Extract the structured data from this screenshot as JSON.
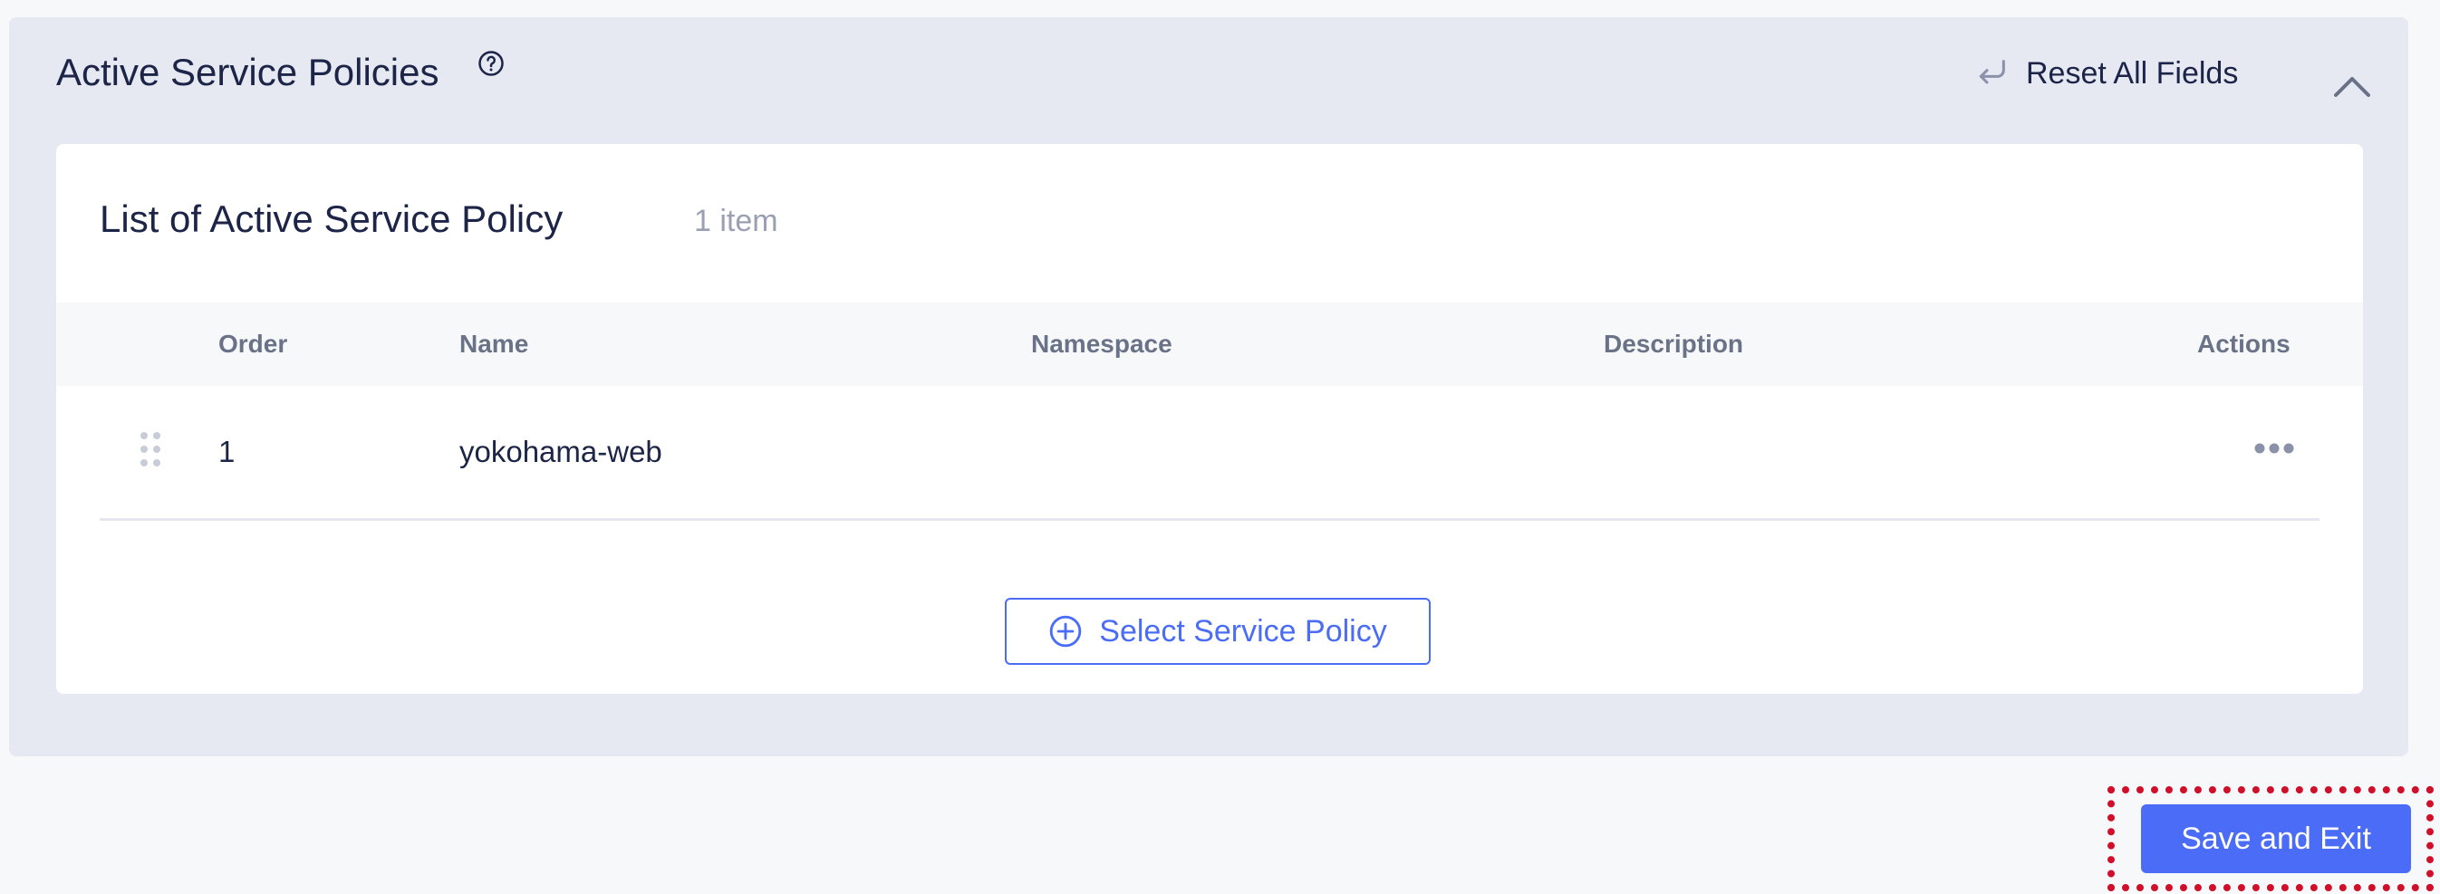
{
  "section": {
    "title": "Active Service Policies",
    "reset_label": "Reset All Fields",
    "icons": {
      "help": "help-circle-icon",
      "reset": "undo-arrow-icon",
      "collapse": "chevron-up-icon"
    }
  },
  "list": {
    "title": "List of Active Service Policy",
    "count": "1 item",
    "columns": [
      "Order",
      "Name",
      "Namespace",
      "Description",
      "Actions"
    ],
    "rows": [
      {
        "order": "1",
        "name": "yokohama-web",
        "namespace": "",
        "description": ""
      }
    ],
    "select_button_label": "Select Service Policy",
    "icons": {
      "drag": "drag-handle-icon",
      "actions": "more-horizontal-icon",
      "add": "plus-circle-icon"
    }
  },
  "footer": {
    "save_label": "Save and Exit"
  },
  "colors": {
    "accent": "#4a6cf7",
    "section_bg": "#e6e8f2",
    "highlight": "#d0102b"
  }
}
